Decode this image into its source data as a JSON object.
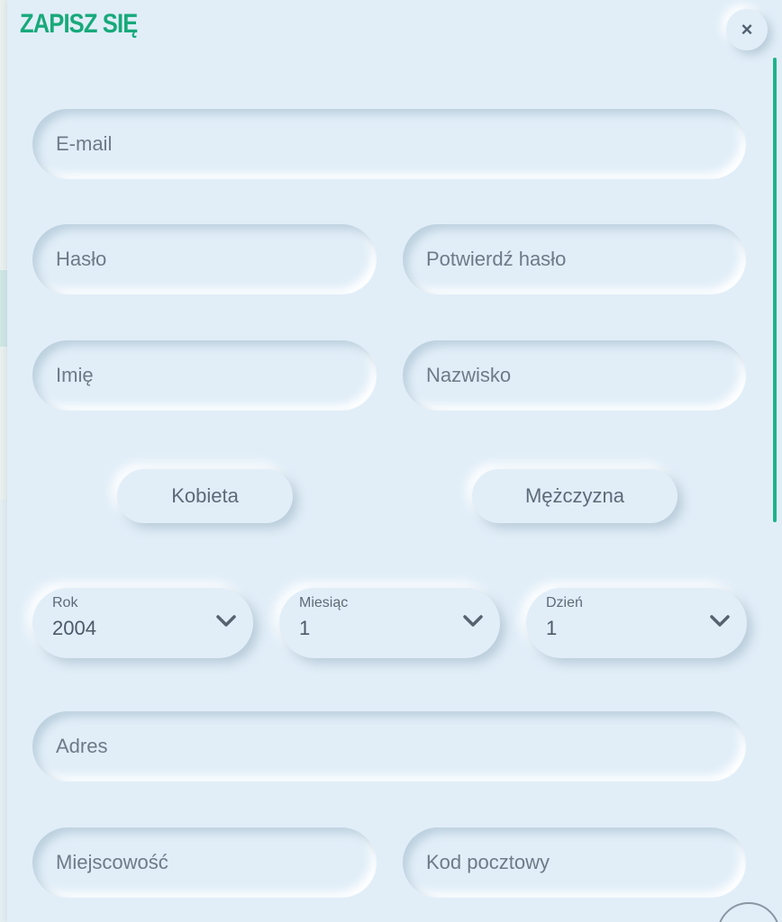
{
  "header": {
    "title": "ZAPISZ SIĘ",
    "close_label": "×"
  },
  "form": {
    "email": {
      "placeholder": "E-mail",
      "value": ""
    },
    "password": {
      "placeholder": "Hasło",
      "value": ""
    },
    "password_confirm": {
      "placeholder": "Potwierdź hasło",
      "value": ""
    },
    "first_name": {
      "placeholder": "Imię",
      "value": ""
    },
    "last_name": {
      "placeholder": "Nazwisko",
      "value": ""
    },
    "gender": {
      "female_label": "Kobieta",
      "male_label": "Mężczyzna"
    },
    "birth": {
      "year": {
        "label": "Rok",
        "value": "2004"
      },
      "month": {
        "label": "Miesiąc",
        "value": "1"
      },
      "day": {
        "label": "Dzień",
        "value": "1"
      }
    },
    "address": {
      "placeholder": "Adres",
      "value": ""
    },
    "city": {
      "placeholder": "Miejscowość",
      "value": ""
    },
    "postal_code": {
      "placeholder": "Kod pocztowy",
      "value": ""
    }
  },
  "icons": {
    "close": "close-icon",
    "dropdown": "chevron-down-icon"
  },
  "colors": {
    "accent": "#18a97a",
    "panel_bg": "#e1eef8",
    "text": "#5d6b78"
  }
}
